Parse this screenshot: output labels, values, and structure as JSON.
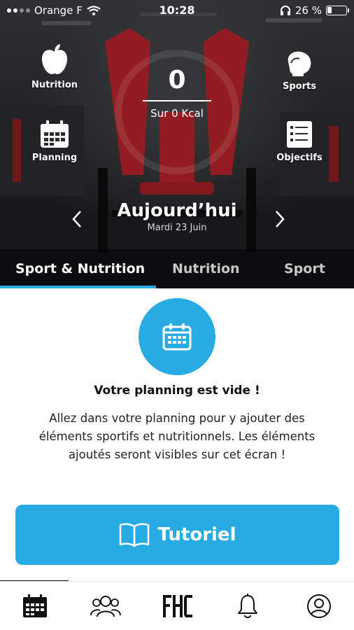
{
  "status_bar": {
    "carrier": "Orange F",
    "time": "10:28",
    "battery_percent": "26 %",
    "battery_level": 0.26,
    "signal_icon": "signal-dots-icon",
    "wifi_icon": "wifi-icon",
    "headphones_icon": "headphones-icon"
  },
  "shortcuts": {
    "nutrition": {
      "label": "Nutrition",
      "icon": "apple-icon"
    },
    "sports": {
      "label": "Sports",
      "icon": "boxing-glove-icon"
    },
    "planning": {
      "label": "Planning",
      "icon": "calendar-icon"
    },
    "objectives": {
      "label": "Objectifs",
      "icon": "checklist-icon"
    }
  },
  "calories": {
    "value": "0",
    "target_text": "Sur 0 Kcal"
  },
  "day_nav": {
    "title": "Aujourd’hui",
    "date": "Mardi 23 Juin",
    "prev_icon": "chevron-left-icon",
    "next_icon": "chevron-right-icon"
  },
  "tabs": [
    {
      "label": "Sport & Nutrition",
      "active": true
    },
    {
      "label": "Nutrition",
      "active": false
    },
    {
      "label": "Sport",
      "active": false
    }
  ],
  "empty_state": {
    "icon": "calendar-icon",
    "title": "Votre planning est vide !",
    "description": "Allez dans votre planning pour y ajouter des éléments sportifs et nutritionnels. Les éléments ajoutés seront visibles sur cet écran !"
  },
  "tutorial_button": {
    "label": "Tutoriel",
    "icon": "open-book-icon"
  },
  "bottom_nav": [
    {
      "name": "calendar",
      "icon": "calendar-icon",
      "active": true
    },
    {
      "name": "community",
      "icon": "users-icon",
      "active": false
    },
    {
      "name": "home",
      "icon": "fhc-logo",
      "logo_text": "FHC",
      "active": false
    },
    {
      "name": "notifications",
      "icon": "bell-icon",
      "active": false
    },
    {
      "name": "profile",
      "icon": "user-icon",
      "active": false
    }
  ],
  "colors": {
    "accent": "#27abe2",
    "machine_red": "#b3232a",
    "text_dark": "#111111"
  }
}
